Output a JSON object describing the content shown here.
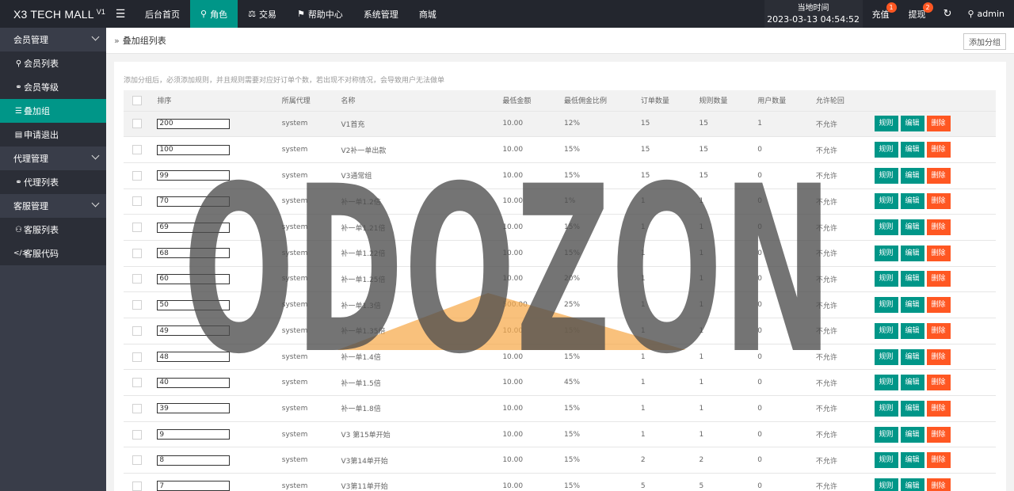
{
  "app": {
    "title": "X3 TECH MALL",
    "version": "V1"
  },
  "topnav": {
    "toggle_icon": "menu-icon",
    "items": [
      {
        "label": "后台首页",
        "icon": ""
      },
      {
        "label": "角色",
        "icon": "user-icon",
        "active": true
      },
      {
        "label": "交易",
        "icon": "scale-icon"
      },
      {
        "label": "帮助中心",
        "icon": "flag-icon"
      },
      {
        "label": "系统管理",
        "icon": ""
      },
      {
        "label": "商城",
        "icon": ""
      }
    ]
  },
  "clock": {
    "label": "当地时间",
    "time": "2023-03-13 04:54:52"
  },
  "topright": {
    "recharge": {
      "label": "充值",
      "badge": "1"
    },
    "withdraw": {
      "label": "提现",
      "badge": "2"
    },
    "user": {
      "name": "admin"
    }
  },
  "sidebar": {
    "groups": [
      {
        "label": "会员管理",
        "items": [
          {
            "label": "会员列表",
            "icon": "user-icon"
          },
          {
            "label": "会员等级",
            "icon": "link-icon"
          },
          {
            "label": "叠加组",
            "icon": "list-icon",
            "active": true
          },
          {
            "label": "申请退出",
            "icon": "doc-icon"
          }
        ]
      },
      {
        "label": "代理管理",
        "items": [
          {
            "label": "代理列表",
            "icon": "link-icon"
          }
        ]
      },
      {
        "label": "客服管理",
        "items": [
          {
            "label": "客服列表",
            "icon": "users-icon"
          },
          {
            "label": "客服代码",
            "icon": "code-icon"
          }
        ]
      }
    ]
  },
  "breadcrumb": "叠加组列表",
  "add_group_label": "添加分组",
  "tip": "添加分组后，必须添加规则，并且规则需要对应好订单个数，若出现不对称情况，会导致用户无法做单",
  "table": {
    "headers": [
      "排序",
      "所属代理",
      "名称",
      "最低金额",
      "最低佣金比例",
      "订单数量",
      "规则数量",
      "用户数量",
      "允许轮回"
    ],
    "actions": {
      "rule": "规则",
      "edit": "编辑",
      "delete": "删除"
    },
    "rows": [
      {
        "sort": "200",
        "agent": "system",
        "name": "V1首充",
        "min": "10.00",
        "rate": "12%",
        "orders": "15",
        "rules": "15",
        "users": "1",
        "loop": "不允许"
      },
      {
        "sort": "100",
        "agent": "system",
        "name": "V2补一单出款",
        "min": "10.00",
        "rate": "15%",
        "orders": "15",
        "rules": "15",
        "users": "0",
        "loop": "不允许"
      },
      {
        "sort": "99",
        "agent": "system",
        "name": "V3通常组",
        "min": "10.00",
        "rate": "15%",
        "orders": "15",
        "rules": "15",
        "users": "0",
        "loop": "不允许"
      },
      {
        "sort": "70",
        "agent": "system",
        "name": "补一单1.2倍",
        "min": "10.00",
        "rate": "1%",
        "orders": "1",
        "rules": "1",
        "users": "0",
        "loop": "不允许"
      },
      {
        "sort": "69",
        "agent": "system",
        "name": "补一单1.21倍",
        "min": "10.00",
        "rate": "15%",
        "orders": "1",
        "rules": "1",
        "users": "0",
        "loop": "不允许"
      },
      {
        "sort": "68",
        "agent": "system",
        "name": "补一单1.22倍",
        "min": "10.00",
        "rate": "15%",
        "orders": "1",
        "rules": "1",
        "users": "0",
        "loop": "不允许"
      },
      {
        "sort": "60",
        "agent": "system",
        "name": "补一单1.25倍",
        "min": "10.00",
        "rate": "20%",
        "orders": "1",
        "rules": "1",
        "users": "0",
        "loop": "不允许"
      },
      {
        "sort": "50",
        "agent": "system",
        "name": "补一单1.3倍",
        "min": "500.00",
        "rate": "25%",
        "orders": "1",
        "rules": "1",
        "users": "0",
        "loop": "不允许"
      },
      {
        "sort": "49",
        "agent": "system",
        "name": "补一单1.35倍",
        "min": "10.00",
        "rate": "15%",
        "orders": "1",
        "rules": "1",
        "users": "0",
        "loop": "不允许"
      },
      {
        "sort": "48",
        "agent": "system",
        "name": "补一单1.4倍",
        "min": "10.00",
        "rate": "15%",
        "orders": "1",
        "rules": "1",
        "users": "0",
        "loop": "不允许"
      },
      {
        "sort": "40",
        "agent": "system",
        "name": "补一单1.5倍",
        "min": "10.00",
        "rate": "45%",
        "orders": "1",
        "rules": "1",
        "users": "0",
        "loop": "不允许"
      },
      {
        "sort": "39",
        "agent": "system",
        "name": "补一单1.8倍",
        "min": "10.00",
        "rate": "15%",
        "orders": "1",
        "rules": "1",
        "users": "0",
        "loop": "不允许"
      },
      {
        "sort": "9",
        "agent": "system",
        "name": "V3 第15单开始",
        "min": "10.00",
        "rate": "15%",
        "orders": "1",
        "rules": "1",
        "users": "0",
        "loop": "不允许"
      },
      {
        "sort": "8",
        "agent": "system",
        "name": "V3第14单开始",
        "min": "10.00",
        "rate": "15%",
        "orders": "2",
        "rules": "2",
        "users": "0",
        "loop": "不允许"
      },
      {
        "sort": "7",
        "agent": "system",
        "name": "V3第11单开始",
        "min": "10.00",
        "rate": "15%",
        "orders": "5",
        "rules": "5",
        "users": "0",
        "loop": "不允许"
      }
    ]
  },
  "watermark": {
    "text": "ODOZON"
  },
  "colors": {
    "accent": "#009688",
    "danger": "#ff5722",
    "topbar": "#23262e",
    "sidebar": "#393d49"
  }
}
